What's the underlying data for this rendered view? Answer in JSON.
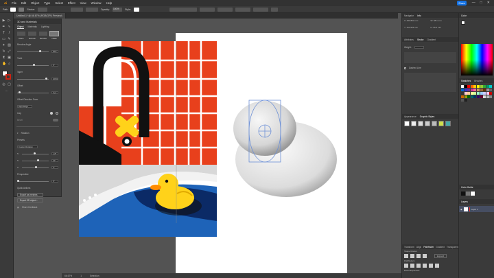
{
  "menu": [
    "Ai",
    "File",
    "Edit",
    "Object",
    "Type",
    "Select",
    "Effect",
    "View",
    "Window",
    "Help"
  ],
  "share_label": "Share",
  "window_controls": [
    "—",
    "□",
    "✕"
  ],
  "control_bar": {
    "selection": "Path",
    "stroke_label": "Stroke:",
    "opacity_label": "Opacity:",
    "opacity_value": "100%",
    "style_label": "Style:"
  },
  "doc_tabs": [
    "Untitled-1* @ 66.67% (RGB/GPU Preview)"
  ],
  "left_panel": {
    "title": "3D and Materials",
    "tabs": [
      "Object",
      "Materials",
      "Lighting"
    ],
    "shape_icons": [
      "Plane",
      "Extrude",
      "Revolve",
      "Inflate"
    ],
    "rows": [
      {
        "label": "Revolve Angle",
        "value": "360°"
      },
      {
        "label": "Twist",
        "value": "0°"
      },
      {
        "label": "Taper",
        "value": "100%"
      },
      {
        "label": "Offset",
        "value": "0 px"
      }
    ],
    "offset_direction_label": "Offset Direction From",
    "offset_direction_value": "Right Edge",
    "cap_label": "Cap",
    "bevel_label": "Bevel",
    "rotation_label": "Rotation",
    "presets_label": "Presets",
    "presets_value": "Custom Rotation",
    "rot_rows": [
      {
        "value": "-18°"
      },
      {
        "value": "24°"
      },
      {
        "value": "0°"
      }
    ],
    "perspective_label": "Perspective",
    "perspective_value": "0°",
    "quick_actions_label": "Quick Actions",
    "export_mesh": "Export as meshes",
    "export_3d": "Export 3D object...",
    "share_feedback": "Share feedback"
  },
  "right_panel": {
    "tabs_top": [
      "Navigator",
      "Info"
    ],
    "info": {
      "x": "X: 460.862 mm",
      "y": "Y: 154.923 mm",
      "w": "W: 58.1 mm",
      "h": "H: 96.4 mm"
    },
    "tabs_mid": [
      "Attributes",
      "Stroke",
      "Gradient"
    ],
    "weight_label": "Weight:",
    "dashed_label": "Dashed Line",
    "tabs_gs": [
      "Appearance",
      "Graphic Styles"
    ],
    "tabs_bottom": [
      "Transform",
      "Align",
      "Pathfinder",
      "Gradient",
      "Transparency"
    ],
    "shape_modes_label": "Shape Modes:",
    "expand_label": "Expand",
    "pathfinders_label": "Pathfinders:",
    "brand_expanded": "Brand Expanded"
  },
  "far_right": {
    "tabs_color": [
      "Color"
    ],
    "tabs_sw": [
      "Swatches",
      "Brushes"
    ],
    "tabs_cg": [
      "Color Guide"
    ],
    "tabs_layers": [
      "Layers"
    ],
    "layer_name": "Layer 1"
  },
  "status": {
    "zoom": "66.67%",
    "artboard": "1",
    "tool": "Selection"
  }
}
